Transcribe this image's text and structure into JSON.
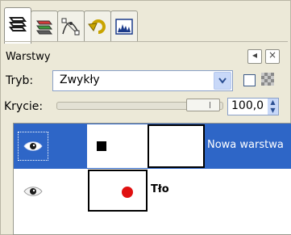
{
  "tabs": [
    {
      "name": "layers-tab",
      "icon": "layers-icon",
      "active": true
    },
    {
      "name": "channels-tab",
      "icon": "channels-icon",
      "active": false
    },
    {
      "name": "paths-tab",
      "icon": "paths-icon",
      "active": false
    },
    {
      "name": "undo-history-tab",
      "icon": "undo-icon",
      "active": false
    },
    {
      "name": "histogram-tab",
      "icon": "histogram-icon",
      "active": false
    }
  ],
  "panel": {
    "title": "Warstwy",
    "menu_button": "◂",
    "close_button": "×"
  },
  "mode": {
    "label": "Tryb:",
    "value": "Zwykły"
  },
  "opacity": {
    "label": "Krycie:",
    "value": "100,0",
    "level_percent": 100
  },
  "layers": [
    {
      "name": "Nowa warstwa",
      "selected": true,
      "visible": true,
      "thumb_shape": "black-square",
      "has_mask": true
    },
    {
      "name": "Tło",
      "selected": false,
      "visible": true,
      "thumb_shape": "red-dot",
      "has_mask": false
    }
  ],
  "colors": {
    "selection": "#2e66c7",
    "dot": "#e01010",
    "background": "#ece9d8"
  }
}
